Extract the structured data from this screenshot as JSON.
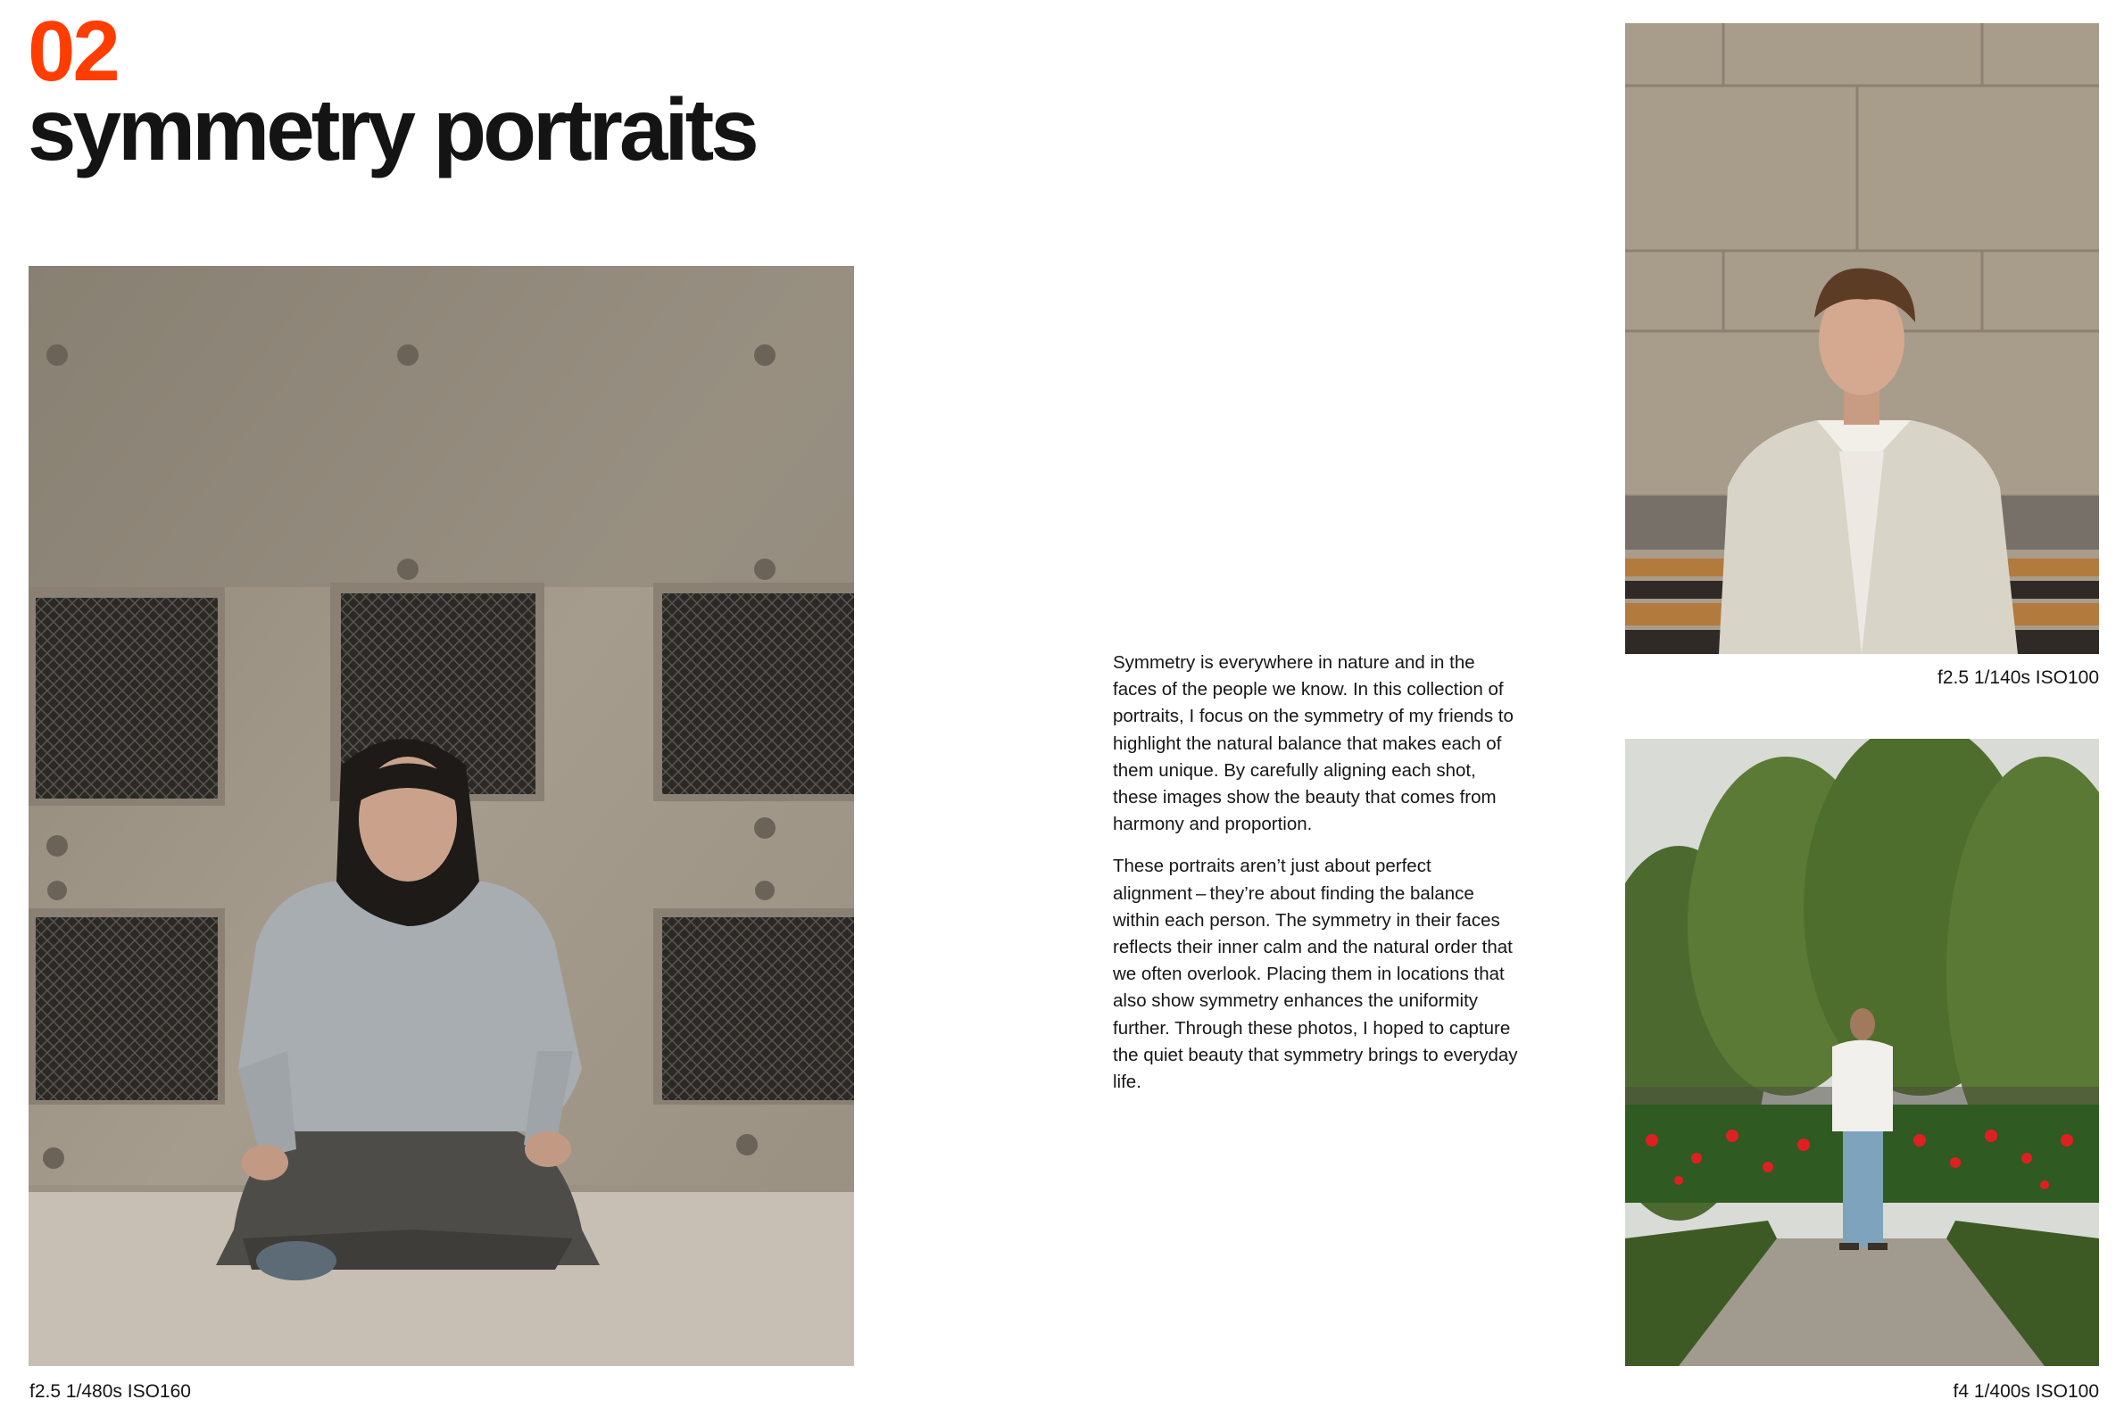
{
  "header": {
    "number": "02",
    "title": "symmetry portraits"
  },
  "body": {
    "paragraphs": [
      "Symmetry is everywhere in nature and in the faces of the people we know. In this collection of portraits, I focus on the symmetry of my friends to highlight the natural balance that makes each of them unique. By carefully aligning each shot, these images show the beauty that comes from harmony and proportion.",
      "These portraits aren’t just about perfect alignment – they’re about finding the balance within each person. The symmetry in their faces reflects their inner calm and the natural order that we often overlook. Placing them in locations that also show symmetry enhances the uniformity further. Through these photos, I hoped to capture the quiet beauty that symmetry brings to everyday life."
    ]
  },
  "photos": {
    "main": {
      "caption": "f2.5 1/480s ISO160"
    },
    "top": {
      "caption": "f2.5 1/140s ISO100"
    },
    "bottom": {
      "caption": "f4 1/400s ISO100"
    }
  },
  "colors": {
    "accent": "#ff3d00",
    "text": "#141414"
  }
}
